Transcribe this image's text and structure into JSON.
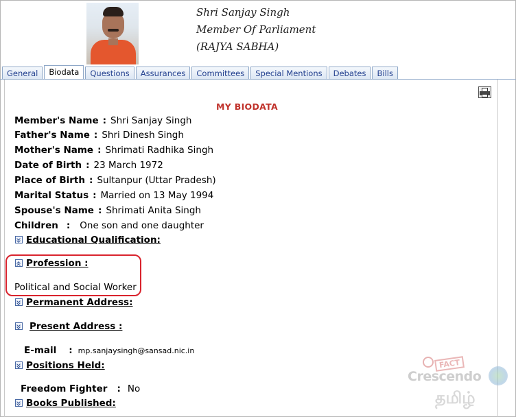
{
  "member": {
    "name_line": "Shri Sanjay Singh",
    "role_line": "Member Of Parliament",
    "house_line": "(RAJYA SABHA)"
  },
  "tabs": [
    {
      "label": "General",
      "active": false
    },
    {
      "label": "Biodata",
      "active": true
    },
    {
      "label": "Questions",
      "active": false
    },
    {
      "label": "Assurances",
      "active": false
    },
    {
      "label": "Committees",
      "active": false
    },
    {
      "label": "Special Mentions",
      "active": false
    },
    {
      "label": "Debates",
      "active": false
    },
    {
      "label": "Bills",
      "active": false
    }
  ],
  "biodata": {
    "title": "MY BIODATA",
    "fields": [
      {
        "label": "Member's Name",
        "value": "Shri Sanjay Singh"
      },
      {
        "label": "Father's Name",
        "value": "Shri Dinesh Singh"
      },
      {
        "label": "Mother's Name",
        "value": "Shrimati Radhika Singh"
      },
      {
        "label": "Date of Birth",
        "value": "23 March 1972"
      },
      {
        "label": "Place of Birth",
        "value": "Sultanpur (Uttar Pradesh)"
      },
      {
        "label": "Marital Status",
        "value": "Married on 13 May 1994"
      },
      {
        "label": "Spouse's Name",
        "value": "Shrimati Anita Singh"
      },
      {
        "label": "Children",
        "value": "One son and one daughter"
      }
    ],
    "sections": {
      "education": "Educational Qualification:",
      "profession": "Profession :",
      "profession_value": "Political and Social Worker",
      "permanent_address": "Permanent Address:",
      "present_address": "Present Address :",
      "email_label": "E-mail",
      "email_value": "mp.sanjaysingh@sansad.nic.in",
      "positions": "Positions Held:",
      "freedom_label": "Freedom Fighter",
      "freedom_value": "No",
      "books": "Books Published:"
    }
  },
  "watermark": {
    "fact": "FACT",
    "crescendo": "Crescendo",
    "tamil": "தமிழ்"
  },
  "colors": {
    "title_red": "#c0322b",
    "highlight_red": "#d9232d",
    "tab_text": "#23408f"
  },
  "icons": [
    "printer-icon",
    "expand-icon",
    "collapse-icon"
  ]
}
